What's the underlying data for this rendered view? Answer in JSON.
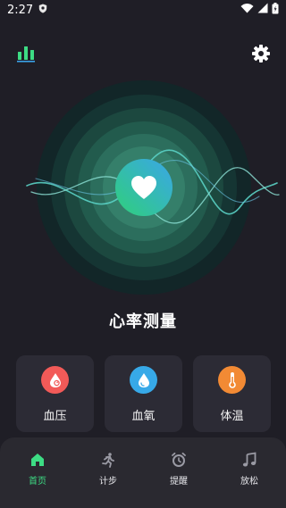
{
  "status_bar": {
    "time": "2:27"
  },
  "main": {
    "title": "心率测量"
  },
  "cards": [
    {
      "label": "血压",
      "color": "#f25a58"
    },
    {
      "label": "血氧",
      "color": "#37a9e8"
    },
    {
      "label": "体温",
      "color": "#f28a34"
    }
  ],
  "tabs": [
    {
      "label": "首页",
      "icon": "home-icon",
      "active": true
    },
    {
      "label": "计步",
      "icon": "runner-icon",
      "active": false
    },
    {
      "label": "提醒",
      "icon": "alarm-clock-icon",
      "active": false
    },
    {
      "label": "放松",
      "icon": "music-note-icon",
      "active": false
    }
  ],
  "colors": {
    "accent": "#3ddc84",
    "background": "#1f1e26",
    "card": "#2c2b35",
    "tab_inactive": "#9a9aa4"
  }
}
